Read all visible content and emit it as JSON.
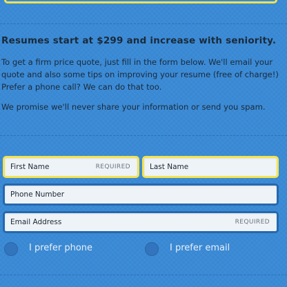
{
  "intro": {
    "headline": "Resumes start at $299 and increase with seniority.",
    "paragraph_lines": [
      "To get a firm price quote, just fill in the form below. We'll email your",
      "quote and also some tips on improving your resume (free of charge!)",
      "Prefer a phone call? We can do that too."
    ],
    "privacy_note": "We promise we'll never share your information or send you spam."
  },
  "form": {
    "first_name": {
      "label": "First Name",
      "required": "REQUIRED"
    },
    "last_name": {
      "label": "Last Name"
    },
    "phone": {
      "label": "Phone Number"
    },
    "email": {
      "label": "Email Address",
      "required": "REQUIRED"
    },
    "contact_options": [
      {
        "label": "I prefer phone"
      },
      {
        "label": "I prefer email"
      }
    ]
  },
  "colors": {
    "background": "#3a8ad6",
    "highlight_border": "#f4e34f",
    "field_border": "#2568ad",
    "field_fill": "#eef3f8"
  }
}
